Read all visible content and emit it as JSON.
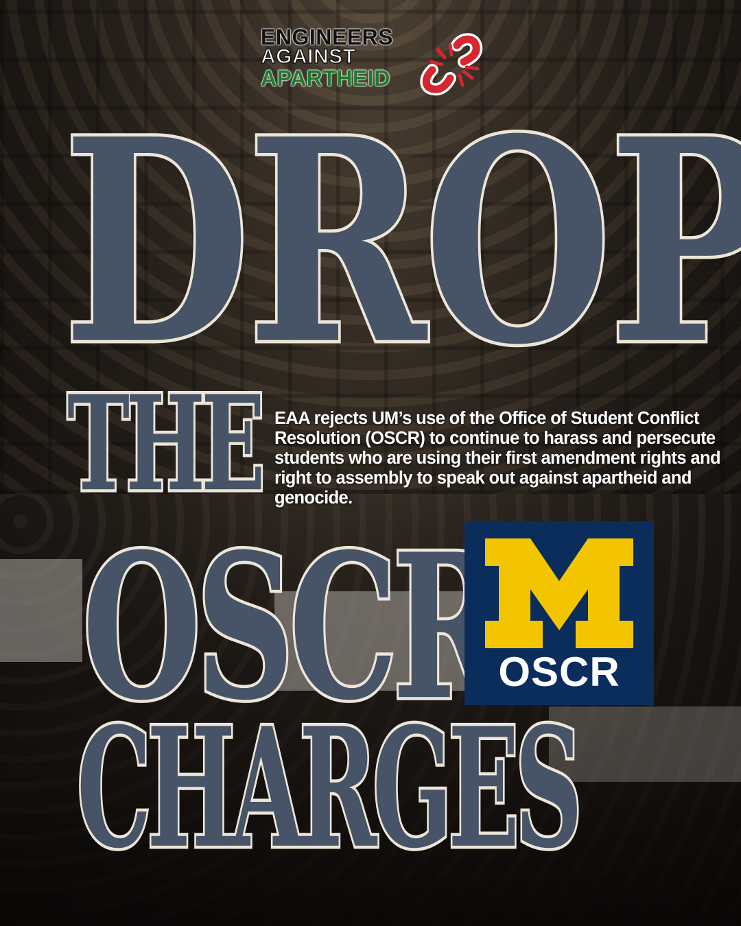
{
  "logo": {
    "line1": "ENGINEERS",
    "line2": "AGAINST",
    "line3": "APARTHEID"
  },
  "headline": {
    "word1": "DROP",
    "word2": "THE",
    "word3": "OSCR",
    "word4": "CHARGES"
  },
  "description": "EAA rejects  UM’s use of the Office of Student Conflict Resolution (OSCR) to continue to harass and persecute students  who are using their first amendment rights and right to assembly to speak out against apartheid and genocide.",
  "badge": {
    "label": "OSCR",
    "letter": "M"
  },
  "colors": {
    "title_fill": "#475366",
    "title_outline": "#ece6d8",
    "badge_bg": "#0b2d5c",
    "maize": "#f2c500",
    "logo_red": "#d62630",
    "logo_green": "#1f7a2e"
  }
}
